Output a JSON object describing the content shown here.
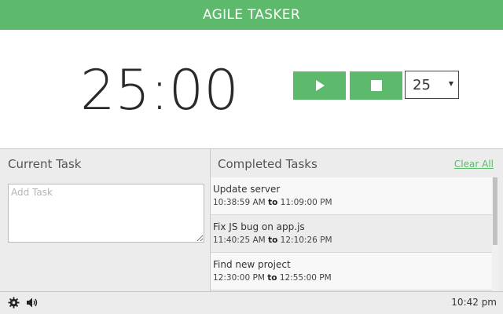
{
  "app": {
    "title": "AGILE TASKER"
  },
  "timer": {
    "display": "25:00",
    "play_icon": "play-icon",
    "stop_icon": "stop-icon",
    "duration_value": "25"
  },
  "current": {
    "title": "Current Task",
    "input_placeholder": "Add Task",
    "input_value": ""
  },
  "completed": {
    "title": "Completed Tasks",
    "clear_label": "Clear All",
    "tasks": [
      {
        "name": "Update server",
        "start": "10:38:59 AM",
        "sep": "to",
        "end": "11:09:00 PM"
      },
      {
        "name": "Fix JS bug on app.js",
        "start": "11:40:25 AM",
        "sep": "to",
        "end": "12:10:26 PM"
      },
      {
        "name": "Find new project",
        "start": "12:30:00 PM",
        "sep": "to",
        "end": "12:55:00 PM"
      }
    ]
  },
  "footer": {
    "settings_icon": "gear-icon",
    "sound_icon": "speaker-icon",
    "clock": "10:42 pm"
  },
  "colors": {
    "accent": "#5dba6c",
    "panel": "#ececec"
  }
}
